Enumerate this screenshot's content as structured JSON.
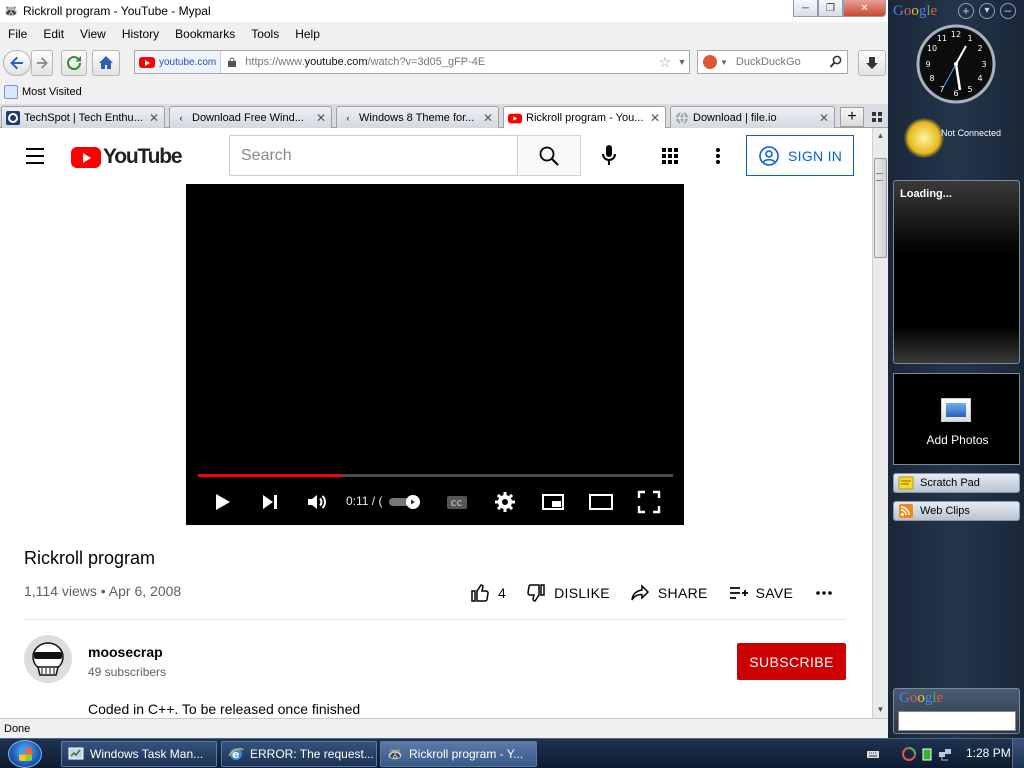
{
  "window": {
    "title": "Rickroll program - YouTube - Mypal",
    "minimize_label": "─",
    "maximize_label": "❐",
    "close_label": "✕"
  },
  "menu": [
    "File",
    "Edit",
    "View",
    "History",
    "Bookmarks",
    "Tools",
    "Help"
  ],
  "navbar": {
    "site_identity": "youtube.com",
    "url_prefix": "https://www.",
    "url_domain": "youtube.com",
    "url_path": "/watch?v=3d05_gFP-4E",
    "search_engine": "DuckDuckGo"
  },
  "bookmarks": {
    "most_visited": "Most Visited"
  },
  "tabs": [
    {
      "label": "TechSpot | Tech Enthu...",
      "icon": "techspot-icon"
    },
    {
      "label": "Download Free Wind...",
      "icon": "loading-icon"
    },
    {
      "label": "Windows 8 Theme for...",
      "icon": "loading-icon"
    },
    {
      "label": "Rickroll program - You...",
      "icon": "youtube-icon",
      "active": true
    },
    {
      "label": "Download | file.io",
      "icon": "globe-icon"
    }
  ],
  "youtube": {
    "logo_text": "YouTube",
    "search_placeholder": "Search",
    "signin_label": "SIGN IN",
    "player": {
      "time_label": "0:11 / (",
      "progress": 0.3
    },
    "title": "Rickroll program",
    "meta": "1,114 views • Apr 6, 2008",
    "likes": "4",
    "dislike_label": "DISLIKE",
    "share_label": "SHARE",
    "save_label": "SAVE",
    "channel_name": "moosecrap",
    "subscribers": "49 subscribers",
    "subscribe_label": "SUBSCRIBE",
    "description": "Coded in C++.  To be released once finished"
  },
  "status_text": "Done",
  "sidebar": {
    "google_label": "Google",
    "weather_status": "Not Connected",
    "loading_text": "Loading...",
    "photos_label": "Add Photos",
    "scratch_pad": "Scratch Pad",
    "web_clips": "Web Clips",
    "search_google_label": "Google"
  },
  "taskbar": {
    "tasks": [
      {
        "label": "Windows Task Man..."
      },
      {
        "label": "ERROR: The request..."
      },
      {
        "label": "Rickroll program - Y...",
        "active": true
      }
    ],
    "clock": "1:28 PM"
  }
}
